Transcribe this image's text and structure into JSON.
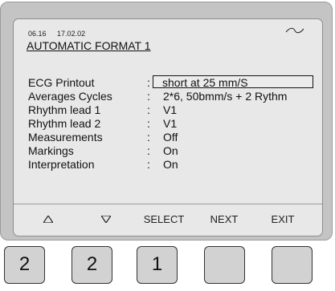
{
  "status": {
    "code": "06.16",
    "time": "17.02.02"
  },
  "screen": {
    "title": "AUTOMATIC FORMAT 1"
  },
  "settings": [
    {
      "label": "ECG Printout",
      "colon": ":",
      "value": "short at 25 mm/S"
    },
    {
      "label": "Averages Cycles",
      "colon": ":",
      "value": "2*6, 50bmm/s + 2 Rythm"
    },
    {
      "label": "Rhythm lead 1",
      "colon": ":",
      "value": "V1"
    },
    {
      "label": "Rhythm lead 2",
      "colon": ":",
      "value": "V1"
    },
    {
      "label": "Measurements",
      "colon": ":",
      "value": "Off"
    },
    {
      "label": "Markings",
      "colon": ":",
      "value": "On"
    },
    {
      "label": "Interpretation",
      "colon": ":",
      "value": "On"
    }
  ],
  "softkeys": {
    "up_icon": "triangle-up-icon",
    "down_icon": "triangle-down-icon",
    "select": "SELECT",
    "next": "NEXT",
    "exit": "EXIT"
  },
  "hardware_keys": [
    "2",
    "2",
    "1",
    "",
    ""
  ],
  "colors": {
    "bezel": "#c4c4c4",
    "screen": "#e8e8e8",
    "key": "#d2d2d2"
  }
}
